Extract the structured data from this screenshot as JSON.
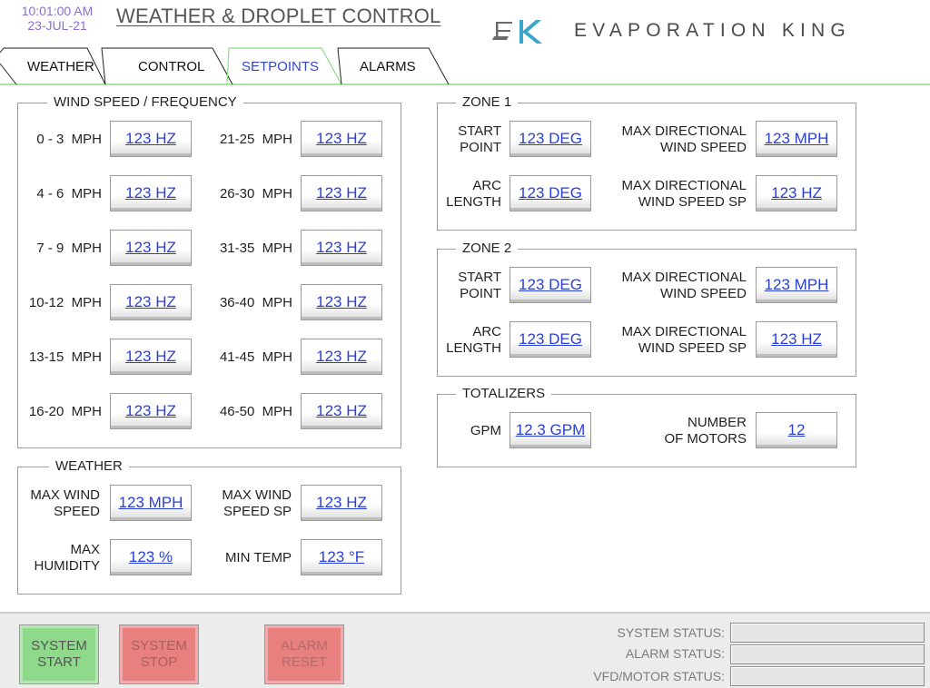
{
  "header": {
    "time": "10:01:00 AM",
    "date": "23-JUL-21",
    "title": "WEATHER & DROPLET CONTROL",
    "brand": "EVAPORATION KING",
    "logo_icon": "ek-logo-icon"
  },
  "tabs": [
    {
      "label": "WEATHER"
    },
    {
      "label": "CONTROL"
    },
    {
      "label": "SETPOINTS",
      "active": true
    },
    {
      "label": "ALARMS"
    }
  ],
  "wind_speed": {
    "title": "WIND SPEED / FREQUENCY",
    "rows": [
      {
        "left_label": "0 - 3  MPH",
        "left_value": "123 HZ",
        "right_label": "21-25  MPH",
        "right_value": "123 HZ"
      },
      {
        "left_label": "4 - 6  MPH",
        "left_value": "123 HZ",
        "right_label": "26-30  MPH",
        "right_value": "123 HZ"
      },
      {
        "left_label": "7 - 9  MPH",
        "left_value": "123 HZ",
        "right_label": "31-35  MPH",
        "right_value": "123 HZ"
      },
      {
        "left_label": "10-12  MPH",
        "left_value": "123 HZ",
        "right_label": "36-40  MPH",
        "right_value": "123 HZ"
      },
      {
        "left_label": "13-15  MPH",
        "left_value": "123 HZ",
        "right_label": "41-45  MPH",
        "right_value": "123 HZ"
      },
      {
        "left_label": "16-20  MPH",
        "left_value": "123 HZ",
        "right_label": "46-50  MPH",
        "right_value": "123 HZ"
      }
    ]
  },
  "weather": {
    "title": "WEATHER",
    "max_wind_speed_label_1": "MAX WIND",
    "max_wind_speed_label_2": "SPEED",
    "max_wind_speed_value": "123 MPH",
    "max_wind_speed_sp_label_1": "MAX WIND",
    "max_wind_speed_sp_label_2": "SPEED SP",
    "max_wind_speed_sp_value": "123 HZ",
    "max_humidity_label_1": "MAX",
    "max_humidity_label_2": "HUMIDITY",
    "max_humidity_value": "123 %",
    "min_temp_label": "MIN TEMP",
    "min_temp_value": "123 °F"
  },
  "zone1": {
    "title": "ZONE 1",
    "start_point_label_1": "START",
    "start_point_label_2": "POINT",
    "start_point_value": "123 DEG",
    "arc_length_label_1": "ARC",
    "arc_length_label_2": "LENGTH",
    "arc_length_value": "123 DEG",
    "max_dir_speed_label_1": "MAX DIRECTIONAL",
    "max_dir_speed_label_2": "WIND SPEED",
    "max_dir_speed_value": "123 MPH",
    "max_dir_speed_sp_label_1": "MAX DIRECTIONAL",
    "max_dir_speed_sp_label_2": "WIND SPEED SP",
    "max_dir_speed_sp_value": "123 HZ"
  },
  "zone2": {
    "title": "ZONE 2",
    "start_point_label_1": "START",
    "start_point_label_2": "POINT",
    "start_point_value": "123 DEG",
    "arc_length_label_1": "ARC",
    "arc_length_label_2": "LENGTH",
    "arc_length_value": "123 DEG",
    "max_dir_speed_label_1": "MAX DIRECTIONAL",
    "max_dir_speed_label_2": "WIND SPEED",
    "max_dir_speed_value": "123 MPH",
    "max_dir_speed_sp_label_1": "MAX DIRECTIONAL",
    "max_dir_speed_sp_label_2": "WIND SPEED SP",
    "max_dir_speed_sp_value": "123 HZ"
  },
  "totalizers": {
    "title": "TOTALIZERS",
    "gpm_label": "GPM",
    "gpm_value": "12.3 GPM",
    "motors_label_1": "NUMBER",
    "motors_label_2": "OF MOTORS",
    "motors_value": "12"
  },
  "footer": {
    "system_start_1": "SYSTEM",
    "system_start_2": "START",
    "system_stop_1": "SYSTEM",
    "system_stop_2": "STOP",
    "alarm_reset_1": "ALARM",
    "alarm_reset_2": "RESET",
    "system_status_label": "SYSTEM STATUS:",
    "system_status_value": "",
    "alarm_status_label": "ALARM STATUS:",
    "alarm_status_value": "",
    "vfd_status_label": "VFD/MOTOR STATUS:",
    "vfd_status_value": ""
  },
  "colors": {
    "link": "#2a3fd8",
    "active_tab": "#3347c7",
    "clock": "#8a6fd0",
    "start_button": "#8fd98a",
    "stop_button": "#e98080",
    "tab_underline": "#8fd98a"
  }
}
